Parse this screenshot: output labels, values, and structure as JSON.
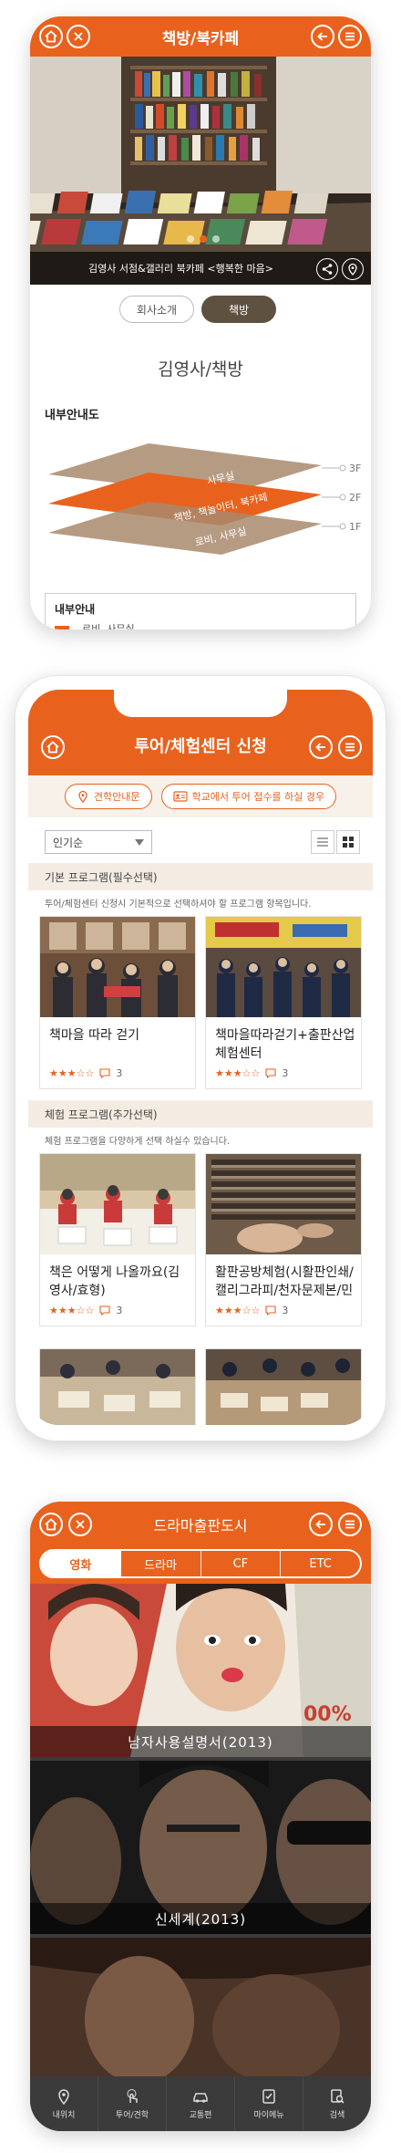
{
  "screen1": {
    "title": "책방/북카페",
    "caption": "김영사 서점&갤러리 북카페 <행복한 마음>",
    "tabs": [
      "회사소개",
      "책방"
    ],
    "active_tab": "책방",
    "heading": "김영사/책방",
    "guide_title": "내부안내도",
    "floors": [
      {
        "label": "3F",
        "text": "사무실"
      },
      {
        "label": "2F",
        "text": "책방, 책놀이터, 북카페"
      },
      {
        "label": "1F",
        "text": "로비, 사무실"
      }
    ],
    "bottom_title": "내부안내",
    "bottom_item": "로비, 사무실",
    "colors": {
      "accent": "#e8621e",
      "brown": "#a9896d"
    }
  },
  "screen2": {
    "title": "투어/체험센터 신청",
    "btn_guide": "견학안내문",
    "btn_school": "학교에서 투어 접수를 하실 경우",
    "sort_value": "인기순",
    "section1": {
      "title": "기본 프로그램(필수선택)",
      "desc": "투어/체험센터 신청시 기본적으로 선택하셔야 할 프로그램 항목입니다.",
      "cards": [
        {
          "title": "책마을 따라 걷기",
          "stars": "★★★☆☆",
          "count": "3"
        },
        {
          "title": "책마을따라걷기+출판산업체험센터",
          "stars": "★★★☆☆",
          "count": "3"
        }
      ]
    },
    "section2": {
      "title": "체험 프로그램(추가선택)",
      "desc": "체험 프로그램을 다양하게 선택 하실수 있습니다.",
      "cards": [
        {
          "title": "책은 어떻게 나올까요(김영사/효형)",
          "stars": "★★★☆☆",
          "count": "3"
        },
        {
          "title": "활판공방체험(시활판인쇄/캘리그라피/천자문제본/민",
          "stars": "★★★☆☆",
          "count": "3"
        }
      ]
    }
  },
  "screen3": {
    "title": "드라마출판도시",
    "tabs": [
      "영화",
      "드라마",
      "CF",
      "ETC"
    ],
    "active_tab": "영화",
    "movies": [
      {
        "caption": "남자사용설명서(2013)"
      },
      {
        "caption": "신세계(2013)"
      }
    ],
    "nav": [
      "내위치",
      "투어/견학",
      "교통편",
      "마이메뉴",
      "검색"
    ]
  }
}
